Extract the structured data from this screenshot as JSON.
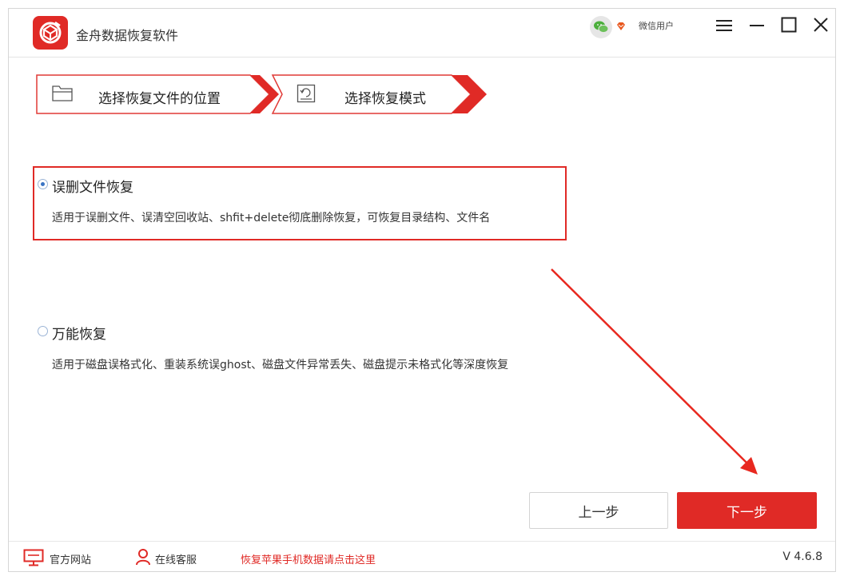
{
  "app": {
    "title": "金舟数据恢复软件",
    "user_name": "微信用户"
  },
  "steps": [
    {
      "label": "选择恢复文件的位置"
    },
    {
      "label": "选择恢复模式"
    }
  ],
  "options": [
    {
      "title": "误删文件恢复",
      "desc": "适用于误删文件、误清空回收站、shfit+delete彻底删除恢复，可恢复目录结构、文件名",
      "selected": true
    },
    {
      "title": "万能恢复",
      "desc": "适用于磁盘误格式化、重装系统误ghost、磁盘文件异常丢失、磁盘提示未格式化等深度恢复",
      "selected": false
    }
  ],
  "buttons": {
    "prev": "上一步",
    "next": "下一步"
  },
  "footer": {
    "website": "官方网站",
    "service": "在线客服",
    "promo": "恢复苹果手机数据请点击这里",
    "version": "V 4.6.8"
  },
  "colors": {
    "accent": "#e02a26",
    "radio": "#3a74c4"
  }
}
